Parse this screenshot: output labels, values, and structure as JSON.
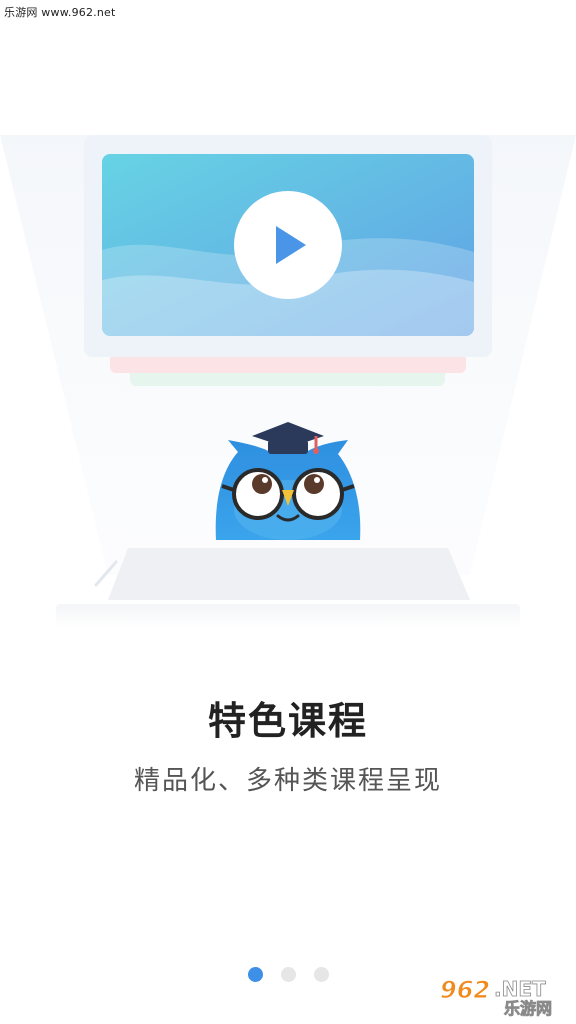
{
  "watermark": {
    "top_text": "乐游网 www.962.net",
    "logo_number": "962",
    "logo_suffix": ".NET",
    "logo_site": "乐游网"
  },
  "onboarding": {
    "title": "特色课程",
    "subtitle": "精品化、多种类课程呈现",
    "pages_total": 3,
    "active_page": 1
  },
  "illustration": {
    "icons": [
      "play-icon",
      "owl-mascot-icon",
      "graduation-cap-icon"
    ]
  },
  "colors": {
    "accent": "#3d8fe8",
    "inactive_dot": "#e6e6e6",
    "title": "#222222",
    "subtitle": "#555555",
    "screen_gradient_start": "#67d3e4",
    "screen_gradient_end": "#5fa0e5",
    "mascot_blue": "#2f8fe0"
  }
}
